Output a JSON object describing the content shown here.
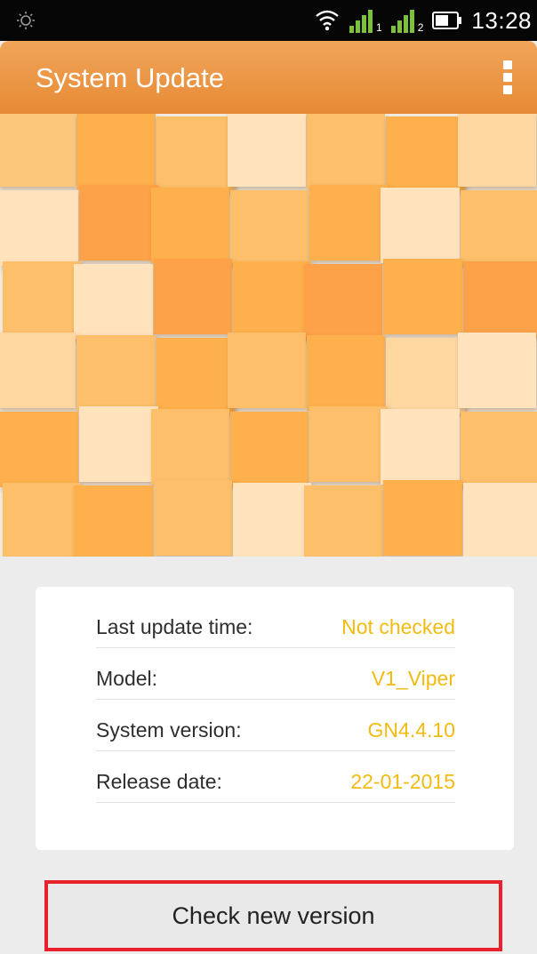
{
  "status_bar": {
    "time": "13:28",
    "icons": [
      "brightness-icon",
      "wifi-icon",
      "signal-sim1-icon",
      "signal-sim2-icon",
      "battery-icon"
    ],
    "sim1_label": "1",
    "sim2_label": "2"
  },
  "app_bar": {
    "title": "System Update",
    "menu_icon": "overflow-menu-icon"
  },
  "info": {
    "rows": [
      {
        "label": "Last update time:",
        "value": "Not checked"
      },
      {
        "label": "Model:",
        "value": "V1_Viper"
      },
      {
        "label": "System version:",
        "value": "GN4.4.10"
      },
      {
        "label": "Release date:",
        "value": "22-01-2015"
      }
    ]
  },
  "actions": {
    "check_label": "Check new version"
  },
  "colors": {
    "app_bar": "#e98f3c",
    "value_text": "#f2bb12",
    "highlight_border": "#e8212c",
    "background": "#ececec"
  }
}
